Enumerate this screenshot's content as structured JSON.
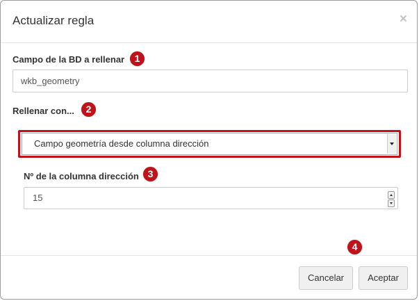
{
  "dialog": {
    "title": "Actualizar regla",
    "close_glyph": "×"
  },
  "fields": {
    "db_field": {
      "label": "Campo de la BD a rellenar",
      "value": "wkb_geometry",
      "badge": "1"
    },
    "fill_with": {
      "label": "Rellenar con...",
      "selected": "Campo geometría desde columna dirección",
      "badge": "2"
    },
    "address_column": {
      "label": "Nº de la columna dirección",
      "value": "15",
      "badge": "3"
    }
  },
  "footer": {
    "badge": "4",
    "cancel_label": "Cancelar",
    "accept_label": "Aceptar"
  },
  "colors": {
    "accent_red": "#c0121b",
    "button_bg": "#f0f0f0",
    "border": "#cccccc"
  },
  "icons": {
    "close": "close-icon",
    "select_arrow": "chevron-down-icon",
    "spin_up": "arrow-up-icon",
    "spin_down": "arrow-down-icon"
  }
}
